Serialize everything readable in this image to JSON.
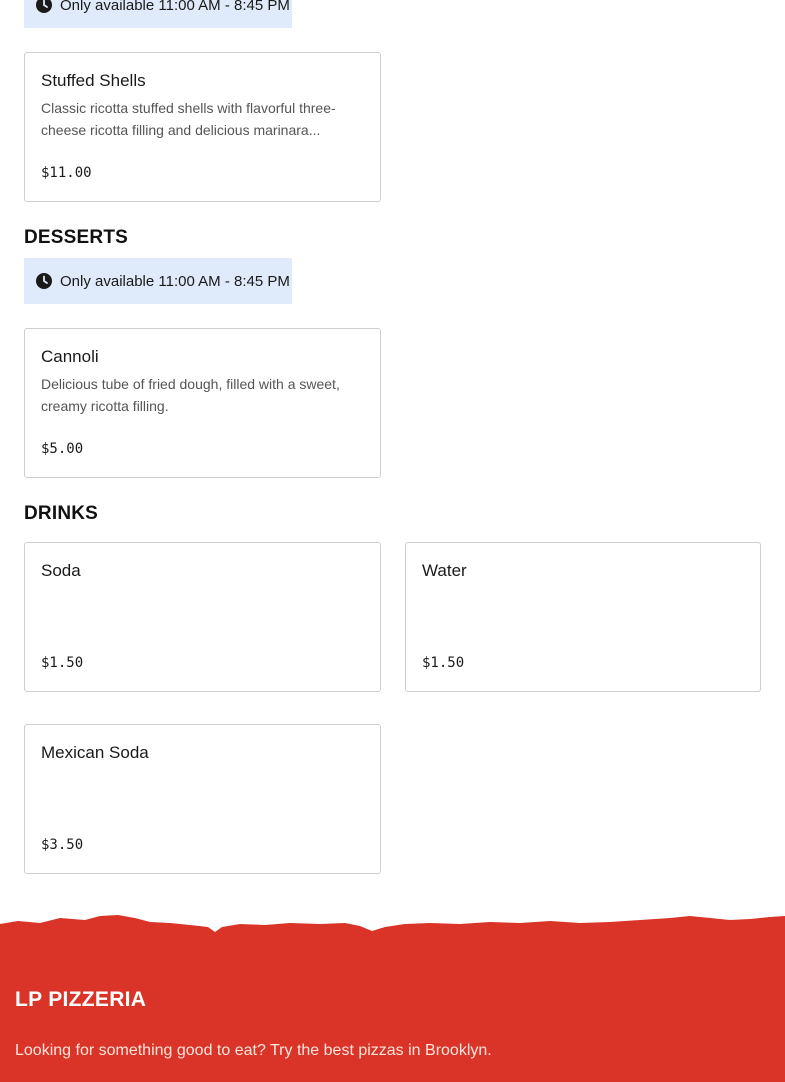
{
  "availability_text": "Only available 11:00 AM - 8:45 PM",
  "sections": {
    "pasta": {
      "items": [
        {
          "name": "Stuffed Shells",
          "description": "Classic ricotta stuffed shells with flavorful three-cheese ricotta filling and delicious marinara...",
          "price": "$11.00"
        }
      ]
    },
    "desserts": {
      "title": "DESSERTS",
      "items": [
        {
          "name": "Cannoli",
          "description": "Delicious tube of fried dough, filled with a sweet, creamy ricotta filling.",
          "price": "$5.00"
        }
      ]
    },
    "drinks": {
      "title": "DRINKS",
      "items": [
        {
          "name": "Soda",
          "price": "$1.50"
        },
        {
          "name": "Water",
          "price": "$1.50"
        },
        {
          "name": "Mexican Soda",
          "price": "$3.50"
        }
      ]
    }
  },
  "footer": {
    "brand": "LP PIZZERIA",
    "tagline": "Looking for something good to eat? Try the best pizzas in Brooklyn."
  },
  "colors": {
    "footer_red": "#d93427",
    "notice_blue": "#dfeafa"
  },
  "icons": {
    "availability": "clock-icon"
  }
}
